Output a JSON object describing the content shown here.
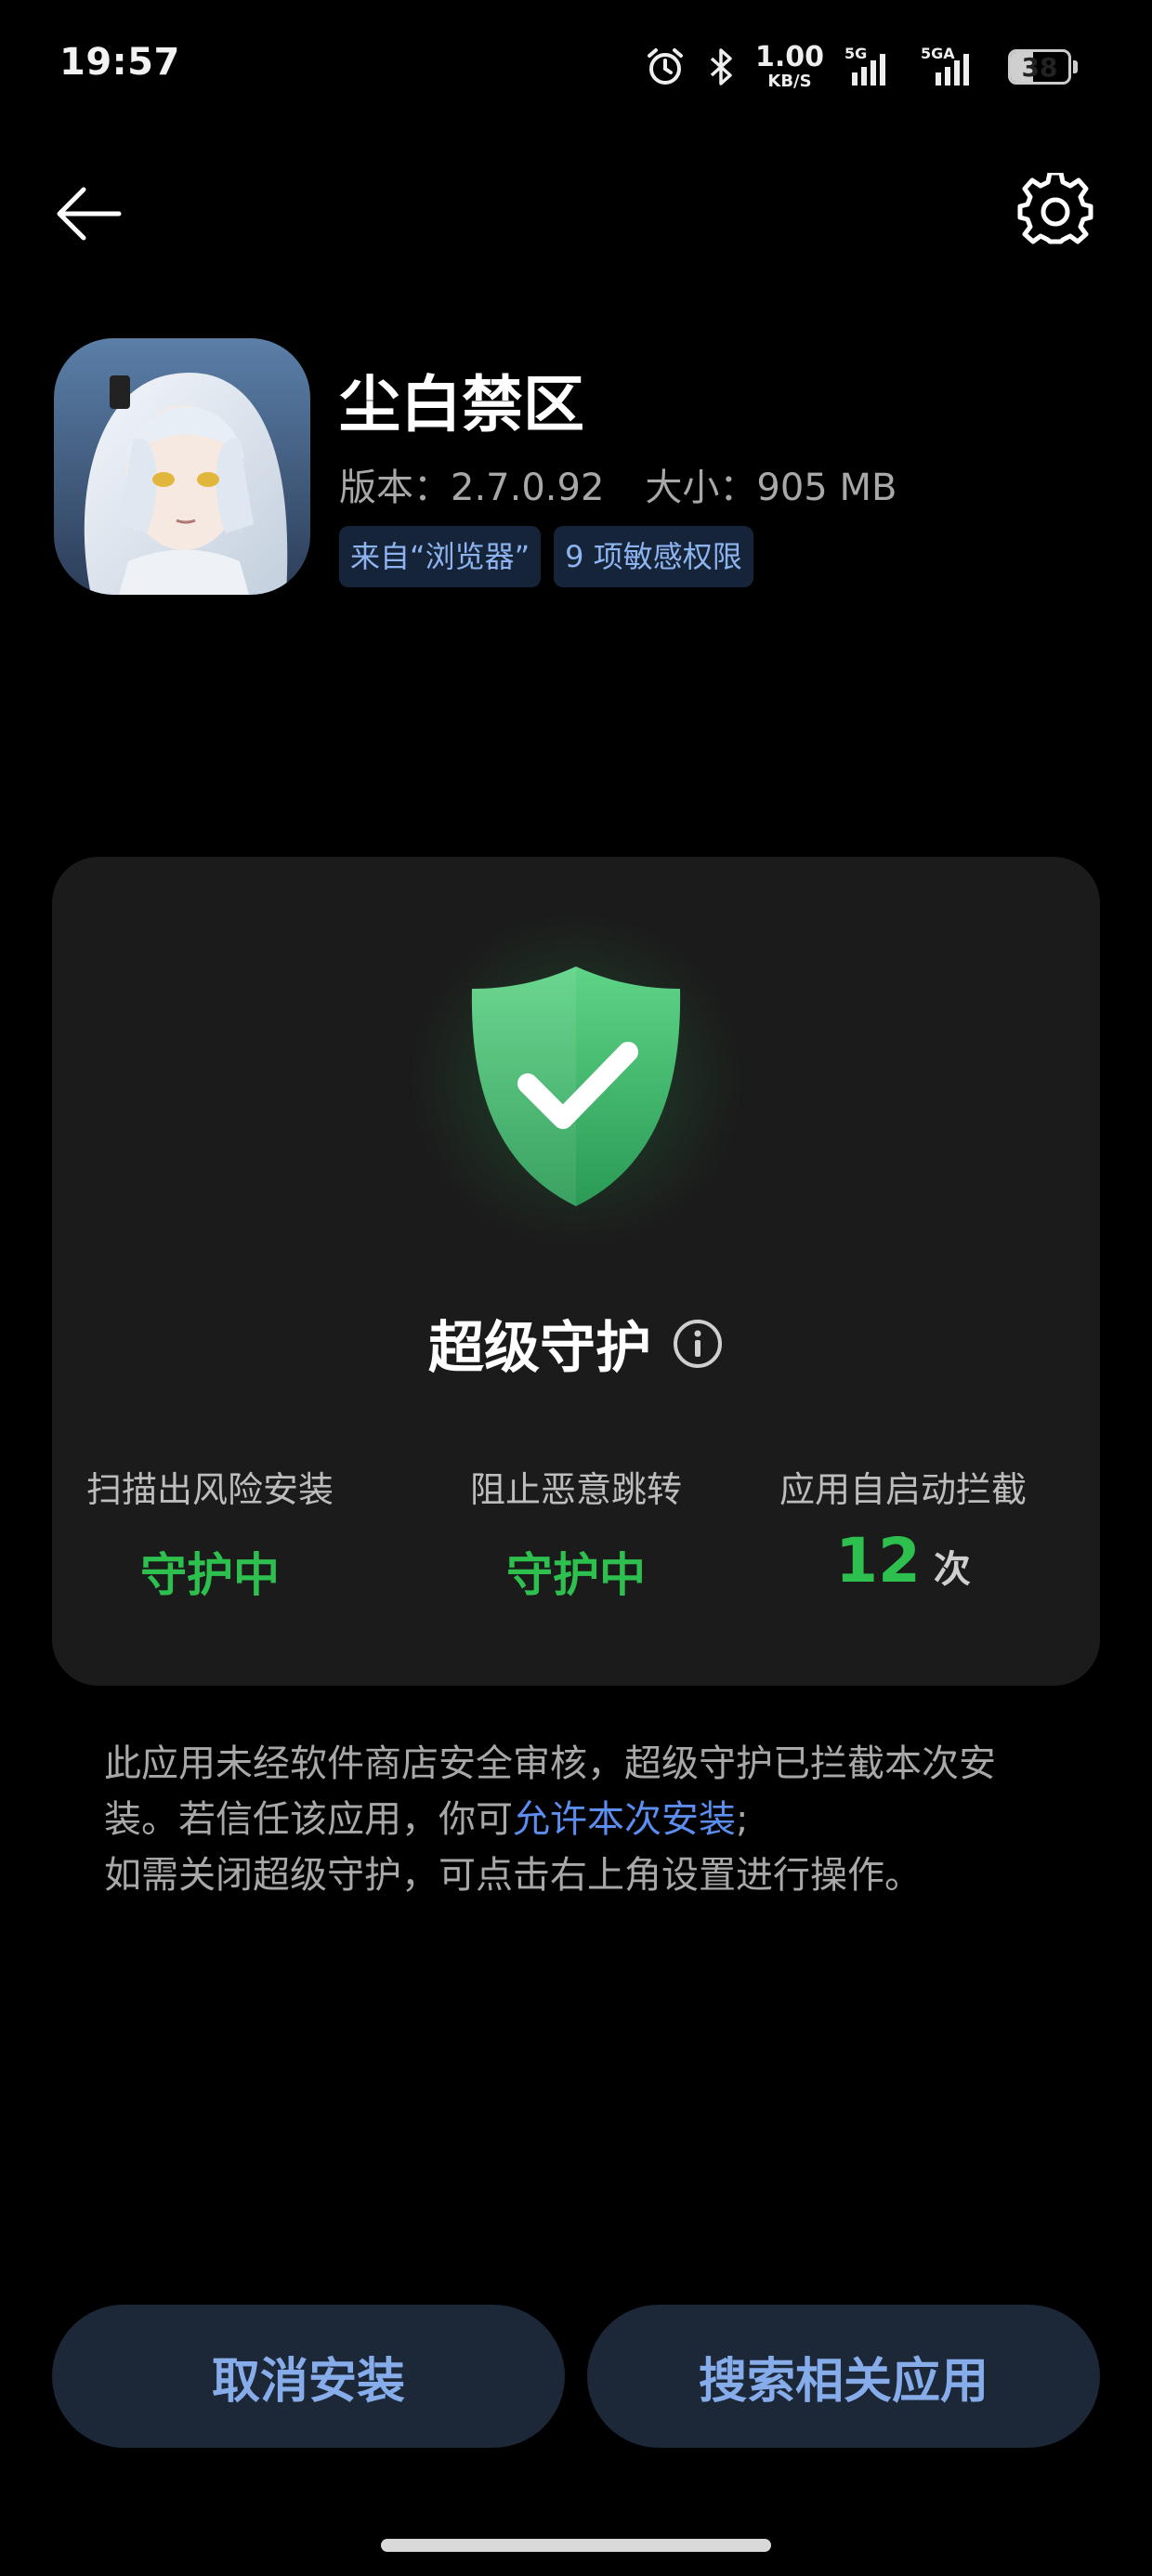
{
  "status_bar": {
    "time": "19:57",
    "net_speed_value": "1.00",
    "net_speed_unit": "KB/S",
    "signal1_label": "5G",
    "signal2_label": "5GA",
    "battery_level": "38",
    "battery_fraction": 0.38,
    "icons": [
      "alarm-icon",
      "bluetooth-icon",
      "signal-icon",
      "battery-icon"
    ]
  },
  "nav": {
    "back_icon": "arrow-left-icon",
    "settings_icon": "gear-icon"
  },
  "app": {
    "name": "尘白禁区",
    "version_label": "版本：",
    "version": "2.7.0.92",
    "size_label": "大小：",
    "size": "905 MB",
    "chips": [
      "来自“浏览器”",
      "9 项敏感权限"
    ]
  },
  "guard": {
    "title": "超级守护",
    "stats": [
      {
        "label": "扫描出风险安装",
        "value": "守护中"
      },
      {
        "label": "阻止恶意跳转",
        "value": "守护中"
      },
      {
        "label": "应用自启动拦截",
        "count": "12",
        "unit": "次"
      }
    ]
  },
  "notice": {
    "part1": "此应用未经软件商店安全审核，超级守护已拦截本次安装。若信任该应用，你可",
    "link": "允许本次安装",
    "part2": ";",
    "line2": "如需关闭超级守护，可点击右上角设置进行操作。"
  },
  "buttons": {
    "cancel": "取消安装",
    "search": "搜索相关应用"
  },
  "colors": {
    "background": "#000000",
    "card": "#1b1b1b",
    "accent_green": "#2ec04f",
    "link_blue": "#5b8ef0",
    "button_bg": "#1c2738",
    "button_text": "#86acea"
  }
}
